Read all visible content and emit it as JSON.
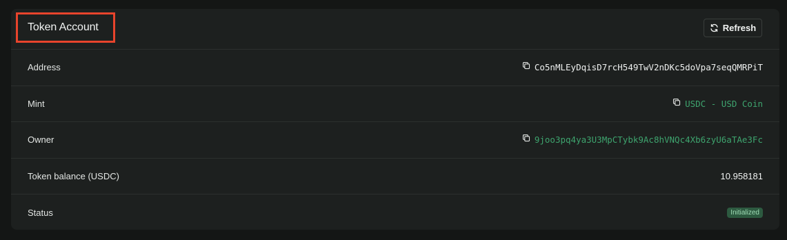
{
  "card": {
    "title": "Token Account",
    "refresh_label": "Refresh"
  },
  "rows": [
    {
      "label": "Address",
      "value": "Co5nMLEyDqisD7rcH549TwV2nDKc5doVpa7seqQMRPiT"
    },
    {
      "label": "Mint",
      "value": "USDC - USD Coin"
    },
    {
      "label": "Owner",
      "value": "9joo3pq4ya3U3MpCTybk9Ac8hVNQc4Xb6zyU6aTAe3Fc"
    },
    {
      "label": "Token balance (USDC)",
      "value": "10.958181"
    },
    {
      "label": "Status",
      "value": "Initialized"
    }
  ],
  "colors": {
    "background": "#141615",
    "card": "#1d201f",
    "link_green": "#3ea46e",
    "badge_bg": "#2d5a40",
    "badge_text": "#9fdcb5",
    "highlight": "#e8442c"
  },
  "icons": {
    "refresh": "refresh-icon",
    "copy": "copy-icon"
  }
}
